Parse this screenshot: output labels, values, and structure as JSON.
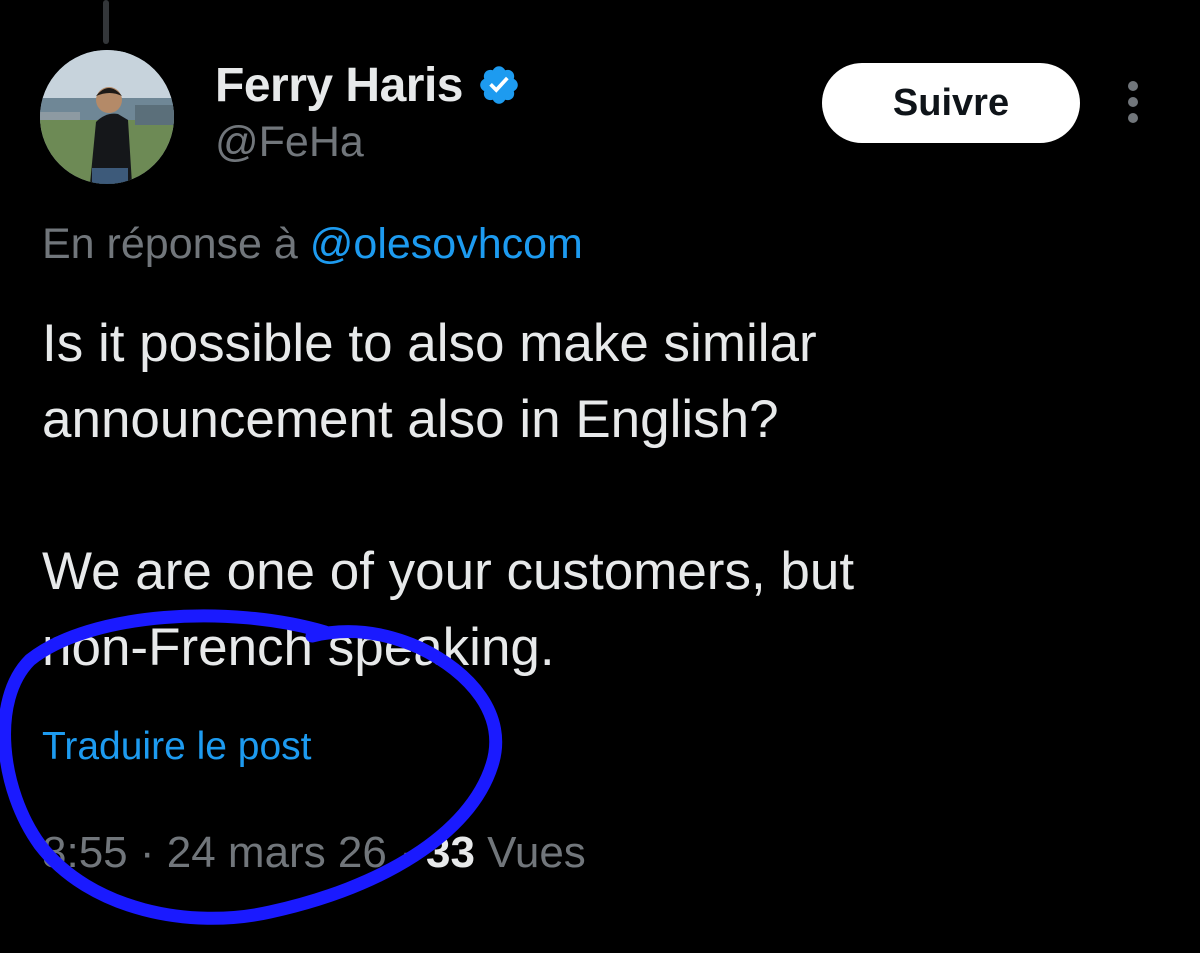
{
  "tweet": {
    "author": {
      "display_name": "Ferry Haris",
      "handle": "@FeHa",
      "verified_icon": "verified-badge-icon"
    },
    "follow_button_label": "Suivre",
    "more_icon": "more-vertical-icon",
    "reply_context": {
      "prefix": "En réponse à ",
      "mention": "@olesovhcom"
    },
    "text_paragraphs": [
      {
        "lines": [
          "Is it possible to also make similar",
          "announcement also in English?"
        ]
      },
      {
        "lines": [
          "We are one of your customers, but",
          "non-French speaking."
        ]
      }
    ],
    "translate_label": "Traduire le post",
    "meta": {
      "time": "8:55",
      "separator": " · ",
      "date": "24 mars 26",
      "views_count": "33",
      "views_label": " Vues"
    }
  },
  "colors": {
    "background": "#000000",
    "text_primary": "#e7e9ea",
    "text_secondary": "#71767b",
    "link": "#1d9bf0",
    "verified": "#1d9bf0",
    "annotation_stroke": "#1a1aff"
  }
}
